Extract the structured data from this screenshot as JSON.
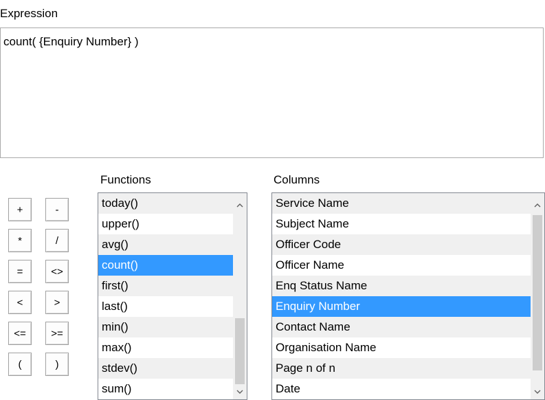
{
  "expression": {
    "label": "Expression",
    "value": "count( {Enquiry Number} )"
  },
  "operators": [
    {
      "label": "+",
      "name": "plus-button"
    },
    {
      "label": "-",
      "name": "minus-button"
    },
    {
      "label": "*",
      "name": "multiply-button"
    },
    {
      "label": "/",
      "name": "divide-button"
    },
    {
      "label": "=",
      "name": "equals-button"
    },
    {
      "label": "<>",
      "name": "not-equal-button"
    },
    {
      "label": "<",
      "name": "less-than-button"
    },
    {
      "label": ">",
      "name": "greater-than-button"
    },
    {
      "label": "<=",
      "name": "less-equal-button"
    },
    {
      "label": ">=",
      "name": "greater-equal-button"
    },
    {
      "label": "(",
      "name": "open-paren-button"
    },
    {
      "label": ")",
      "name": "close-paren-button"
    }
  ],
  "functions": {
    "label": "Functions",
    "items": [
      "today()",
      "upper()",
      "avg()",
      "count()",
      "first()",
      "last()",
      "min()",
      "max()",
      "stdev()",
      "sum()"
    ],
    "selected_index": 3
  },
  "columns": {
    "label": "Columns",
    "items": [
      "Service Name",
      "Subject Name",
      "Officer Code",
      "Officer Name",
      "Enq Status Name",
      "Enquiry Number",
      "Contact Name",
      "Organisation Name",
      "Page n of n",
      "Date"
    ],
    "selected_index": 5
  },
  "icons": {
    "scroll_up": "chevron-up-icon",
    "scroll_down": "chevron-down-icon"
  },
  "colors": {
    "selection": "#3399ff",
    "alt_row": "#f0f0f0"
  }
}
